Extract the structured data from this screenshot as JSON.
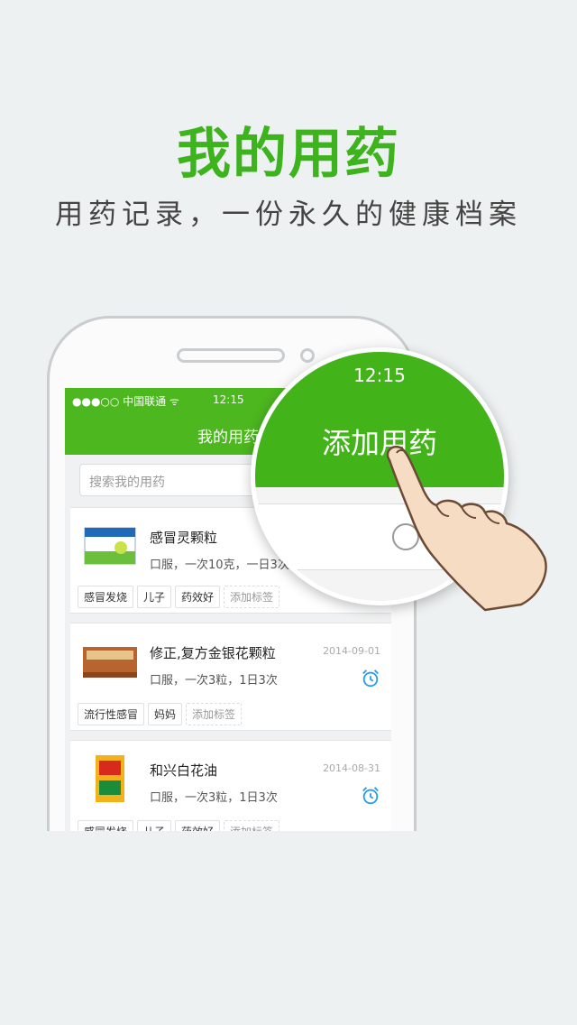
{
  "header": {
    "title": "我的用药",
    "subtitle": "用药记录，一份永久的健康档案"
  },
  "status_bar": {
    "carrier": "●●●○○ 中国联通 ᯤ",
    "time": "12:15"
  },
  "nav": {
    "title": "我的用药"
  },
  "search": {
    "placeholder": "搜索我的用药"
  },
  "medicines": [
    {
      "name": "感冒灵颗粒",
      "dose": "口服，一次10克，一日3次",
      "date": "",
      "tags": [
        "感冒发烧",
        "儿子",
        "药效好"
      ],
      "add_tag": "添加标签"
    },
    {
      "name": "修正,复方金银花颗粒",
      "dose": "口服，一次3粒，1日3次",
      "date": "2014-09-01",
      "tags": [
        "流行性感冒",
        "妈妈"
      ],
      "add_tag": "添加标签"
    },
    {
      "name": "和兴白花油",
      "dose": "口服，一次3粒，1日3次",
      "date": "2014-08-31",
      "tags": [
        "感冒发烧",
        "儿子",
        "药效好"
      ],
      "add_tag": "添加标签"
    }
  ],
  "magnifier": {
    "time": "12:15",
    "title": "添加用药"
  },
  "colors": {
    "brand_green": "#3db31d",
    "nav_green": "#4cb71e",
    "alarm_blue": "#2b9bf0"
  },
  "icons": [
    "wifi-icon",
    "alarm-clock-icon",
    "search-icon",
    "hand-pointer-icon"
  ]
}
